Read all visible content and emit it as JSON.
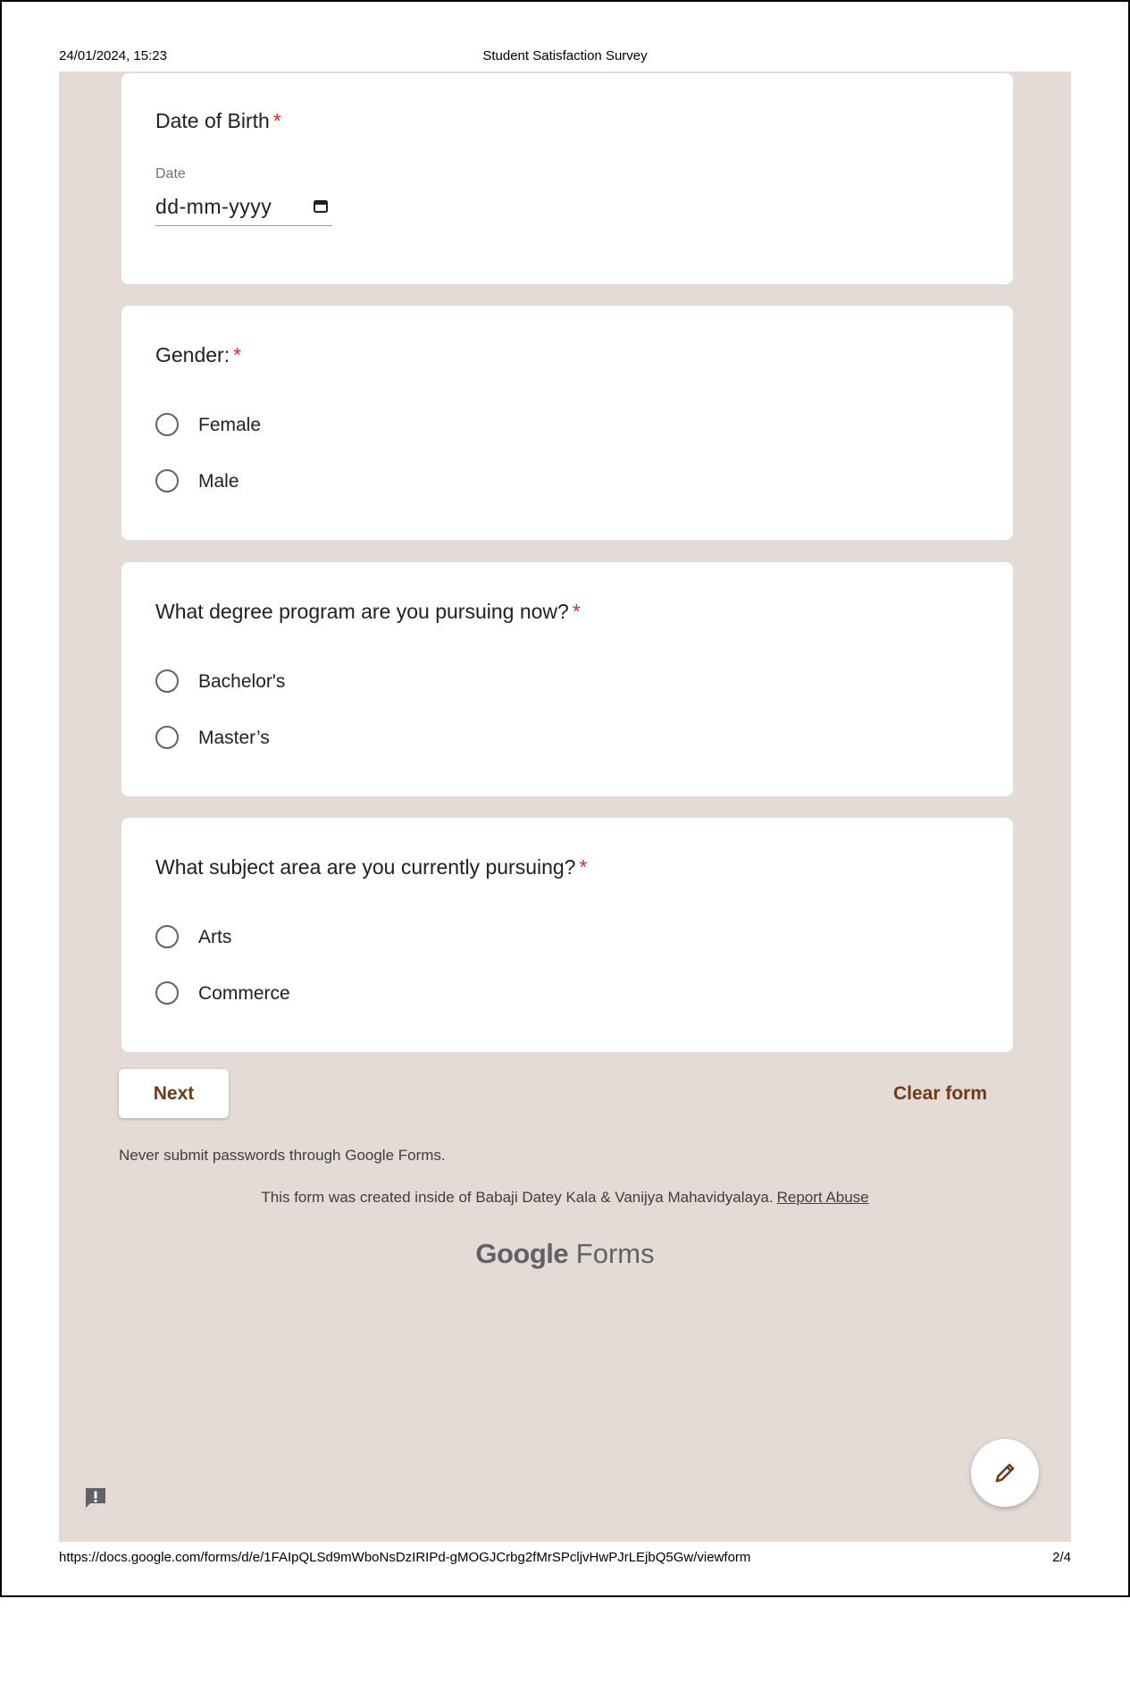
{
  "print_header": {
    "timestamp": "24/01/2024, 15:23",
    "title": "Student Satisfaction Survey"
  },
  "questions": {
    "dob": {
      "title": "Date of Birth",
      "required_mark": "*",
      "field_label": "Date",
      "placeholder": "dd-mm-yyyy"
    },
    "gender": {
      "title": "Gender:",
      "required_mark": "*",
      "options": [
        "Female",
        "Male"
      ]
    },
    "degree": {
      "title": "What degree program are you pursuing now?",
      "required_mark": "*",
      "options": [
        "Bachelor's",
        "Master’s"
      ]
    },
    "subject": {
      "title": "What subject area are you currently pursuing?",
      "required_mark": "*",
      "options": [
        "Arts",
        "Commerce"
      ]
    }
  },
  "actions": {
    "next_label": "Next",
    "clear_label": "Clear form"
  },
  "footer": {
    "password_notice": "Never submit passwords through Google Forms.",
    "created_text": "This form was created inside of Babaji Datey Kala & Vanijya Mahavidyalaya.",
    "report_link": "Report Abuse",
    "brand_bold": "Google",
    "brand_light": "Forms"
  },
  "print_footer": {
    "url": "https://docs.google.com/forms/d/e/1FAIpQLSd9mWboNsDzIRIPd-gMOGJCrbg2fMrSPcljvHwPJrLEjbQ5Gw/viewform",
    "page": "2/4"
  },
  "colors": {
    "background": "#e4dbd7",
    "accent": "#6e3a18",
    "required": "#d93025"
  },
  "icons": [
    "calendar-icon",
    "edit-pencil-icon",
    "report-feedback-icon"
  ]
}
